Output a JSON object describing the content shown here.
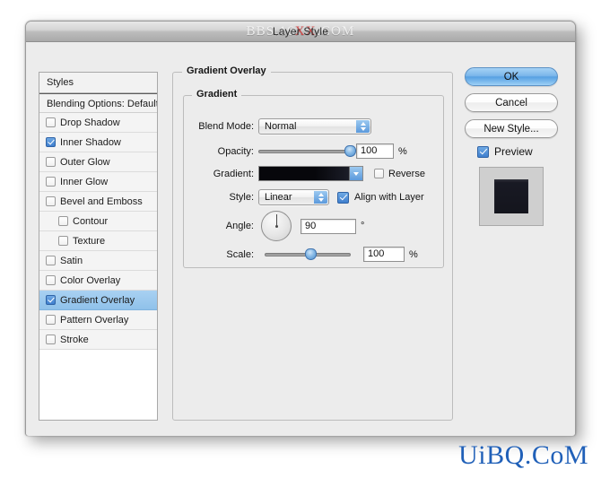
{
  "window": {
    "title": "Layer Style",
    "watermark_title": "BBS.16XX.COM",
    "watermark_title_prefix": "BBS.16",
    "watermark_title_red": "XX",
    "watermark_title_suffix": ".COM",
    "watermark_bottom": "UiBQ.CoM"
  },
  "styles_panel": {
    "header": "Styles",
    "blending_options": "Blending Options: Default",
    "items": [
      {
        "label": "Drop Shadow",
        "checked": false,
        "sub": false,
        "selected": false
      },
      {
        "label": "Inner Shadow",
        "checked": true,
        "sub": false,
        "selected": false
      },
      {
        "label": "Outer Glow",
        "checked": false,
        "sub": false,
        "selected": false
      },
      {
        "label": "Inner Glow",
        "checked": false,
        "sub": false,
        "selected": false
      },
      {
        "label": "Bevel and Emboss",
        "checked": false,
        "sub": false,
        "selected": false
      },
      {
        "label": "Contour",
        "checked": false,
        "sub": true,
        "selected": false
      },
      {
        "label": "Texture",
        "checked": false,
        "sub": true,
        "selected": false
      },
      {
        "label": "Satin",
        "checked": false,
        "sub": false,
        "selected": false
      },
      {
        "label": "Color Overlay",
        "checked": false,
        "sub": false,
        "selected": false
      },
      {
        "label": "Gradient Overlay",
        "checked": true,
        "sub": false,
        "selected": true
      },
      {
        "label": "Pattern Overlay",
        "checked": false,
        "sub": false,
        "selected": false
      },
      {
        "label": "Stroke",
        "checked": false,
        "sub": false,
        "selected": false
      }
    ]
  },
  "settings": {
    "section_title": "Gradient Overlay",
    "group_title": "Gradient",
    "blend_mode": {
      "label": "Blend Mode:",
      "value": "Normal"
    },
    "opacity": {
      "label": "Opacity:",
      "value": "100",
      "unit": "%",
      "percent": 100
    },
    "gradient": {
      "label": "Gradient:",
      "color_start": "#07070b",
      "color_end": "#1b1d28"
    },
    "reverse": {
      "label": "Reverse",
      "checked": false
    },
    "style": {
      "label": "Style:",
      "value": "Linear"
    },
    "align_with_layer": {
      "label": "Align with Layer",
      "checked": true
    },
    "angle": {
      "label": "Angle:",
      "value": "90",
      "unit": "°",
      "degrees": 90
    },
    "scale": {
      "label": "Scale:",
      "value": "100",
      "unit": "%",
      "percent": 53
    }
  },
  "buttons": {
    "ok": "OK",
    "cancel": "Cancel",
    "new_style": "New Style...",
    "preview": {
      "label": "Preview",
      "checked": true
    }
  }
}
